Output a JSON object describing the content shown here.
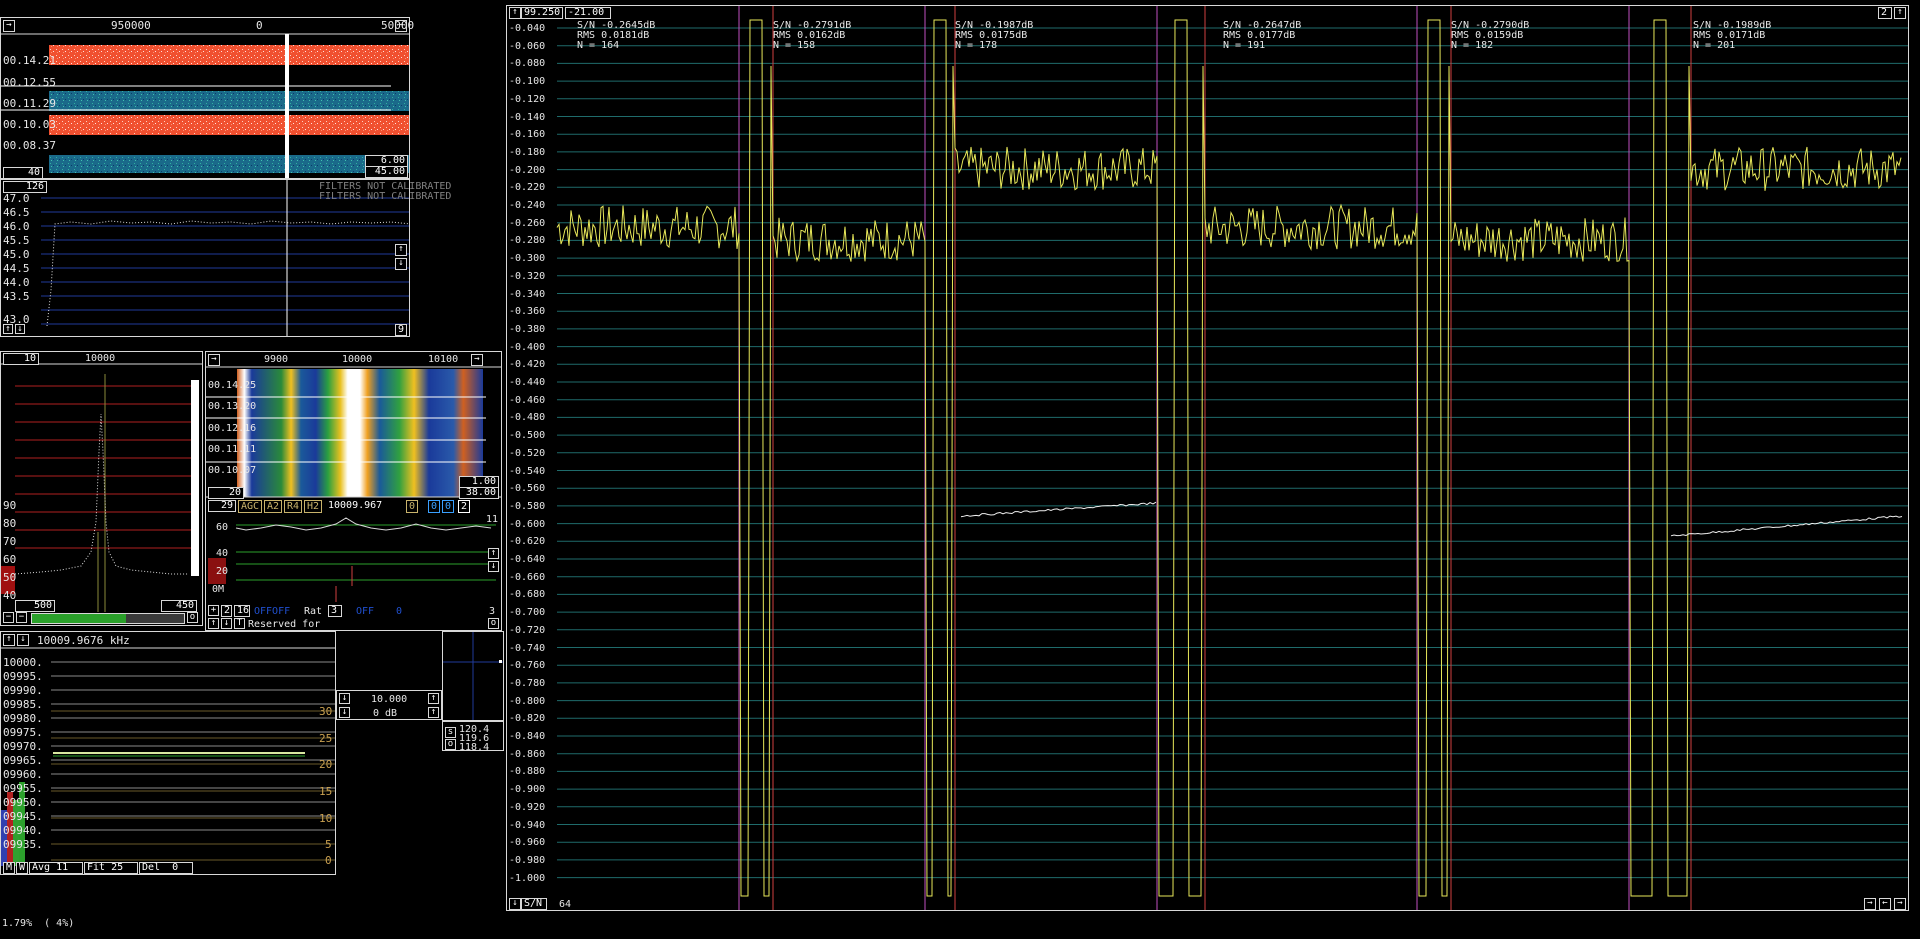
{
  "waterfall_main": {
    "freq_labels": [
      "950000",
      "0",
      "50000"
    ],
    "times": [
      "00.14.21",
      "00.12.55",
      "00.11.29",
      "00.10.03",
      "00.08.37"
    ],
    "bottom_left": "40",
    "bottom_right_top": "6.00",
    "bottom_right": "45.00"
  },
  "spectrum_main": {
    "top_value": "126",
    "notice_line1": "FILTERS NOT CALIBRATED",
    "notice_line2": "FILTERS NOT CALIBRATED",
    "y_ticks": [
      "47.0",
      "46.5",
      "46.0",
      "45.5",
      "45.0",
      "44.5",
      "44.0",
      "43.5",
      "43.0"
    ],
    "corner_value": "9"
  },
  "small_spectrum": {
    "left_value": "10",
    "center_freq": "10000",
    "y_ticks": [
      "90",
      "80",
      "70",
      "60",
      "50",
      "40"
    ],
    "bottom_left": "500",
    "bottom_right": "450"
  },
  "hires_waterfall": {
    "freq_labels": [
      "9900",
      "10000",
      "10100"
    ],
    "times": [
      "00.14.25",
      "00.13.20",
      "00.12.16",
      "00.11.11",
      "00.10.07"
    ],
    "scale_top": "1.00",
    "left_value": "20",
    "right_value": "38.00"
  },
  "rx_controls": {
    "channel": "29",
    "agc": "AGC",
    "a2": "A2",
    "r4": "R4",
    "h2": "H2",
    "freq": "10009.967",
    "box1": "0",
    "box2": "0",
    "box3": "0",
    "box4": "2",
    "level_top": "60",
    "corner_right": "11",
    "level_mid": "40",
    "level_low": "20",
    "level_bottom": "0M",
    "bar_left": "2",
    "bar_val": "16",
    "off_label": "OFFOFF",
    "rat_label": "Rat",
    "rat_value": "3",
    "off2_label": "OFF",
    "off2_value": "0",
    "bar_right": "3",
    "reserved": "Reserved for"
  },
  "freq_track": {
    "title": "10009.9676 kHz",
    "y_ticks": [
      "10000.",
      "09995.",
      "09990.",
      "09985.",
      "09980.",
      "09975.",
      "09970.",
      "09965.",
      "09960.",
      "09955.",
      "09950.",
      "09945.",
      "09940.",
      "09935."
    ],
    "r_ticks": [
      "30",
      "25",
      "20",
      "15",
      "10",
      "5",
      "0"
    ],
    "m_btn": "M",
    "w_btn": "W",
    "avg": "Avg 11",
    "fit": "Fit 25",
    "del": "Del  0"
  },
  "mid_controls": {
    "value1": "10.000",
    "value2": "0 dB"
  },
  "readouts": {
    "v1": "120.4",
    "v2": "119.6",
    "v3": "118.4",
    "s_label": "s",
    "o_label": "o"
  },
  "main_plot": {
    "header_left": "99.250",
    "header_mid": "-21.00",
    "corner_right": "2",
    "footer_label": "S/N",
    "footer_value": "64",
    "y_ticks": [
      "-0.040",
      "-0.060",
      "-0.080",
      "-0.100",
      "-0.120",
      "-0.140",
      "-0.160",
      "-0.180",
      "-0.200",
      "-0.220",
      "-0.240",
      "-0.260",
      "-0.280",
      "-0.300",
      "-0.320",
      "-0.340",
      "-0.360",
      "-0.380",
      "-0.400",
      "-0.420",
      "-0.440",
      "-0.460",
      "-0.480",
      "-0.500",
      "-0.520",
      "-0.540",
      "-0.560",
      "-0.580",
      "-0.600",
      "-0.620",
      "-0.640",
      "-0.660",
      "-0.680",
      "-0.700",
      "-0.720",
      "-0.740",
      "-0.760",
      "-0.780",
      "-0.800",
      "-0.820",
      "-0.840",
      "-0.860",
      "-0.880",
      "-0.900",
      "-0.920",
      "-0.940",
      "-0.960",
      "-0.980",
      "-1.000"
    ],
    "stats": [
      {
        "sn": "S/N -0.2645dB",
        "rms": "RMS 0.0181dB",
        "n": "N = 164"
      },
      {
        "sn": "S/N -0.2791dB",
        "rms": "RMS 0.0162dB",
        "n": "N = 158"
      },
      {
        "sn": "S/N -0.1987dB",
        "rms": "RMS 0.0175dB",
        "n": "N = 178"
      },
      {
        "sn": "S/N -0.2647dB",
        "rms": "RMS 0.0177dB",
        "n": "N = 191"
      },
      {
        "sn": "S/N -0.2790dB",
        "rms": "RMS 0.0159dB",
        "n": "N = 182"
      },
      {
        "sn": "S/N -0.1989dB",
        "rms": "RMS 0.0171dB",
        "n": "N = 201"
      }
    ]
  },
  "status_line": "1.79%  ( 4%)",
  "colors": {
    "trace": "#e8e85a",
    "grid_cyan": "#1f6b6b",
    "grid_red": "#b02020",
    "marker_magenta": "#c050c0",
    "marker_red": "#d04040",
    "green_line": "#2ca02c"
  }
}
